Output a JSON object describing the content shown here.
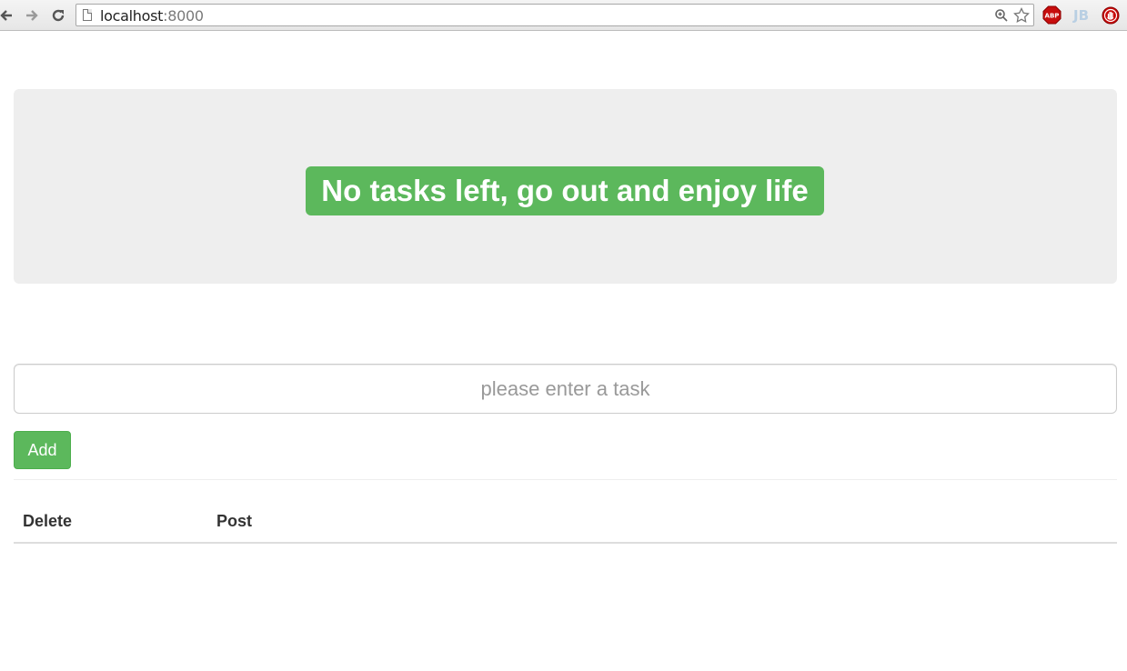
{
  "browser": {
    "url_host": "localhost",
    "url_port": ":8000",
    "icons": {
      "back": "arrow-left-icon",
      "forward": "arrow-right-icon",
      "reload": "reload-icon",
      "page": "page-icon",
      "zoom": "zoom-icon",
      "bookmark": "star-icon"
    },
    "extensions": {
      "abp_label": "ABP",
      "jb_label": "JB"
    }
  },
  "banner": {
    "message": "No tasks left, go out and enjoy life",
    "color": "#5cb85c",
    "background": "#eeeeee"
  },
  "form": {
    "task_placeholder": "please enter a task",
    "task_value": "",
    "add_label": "Add"
  },
  "table": {
    "columns": [
      "Delete",
      "Post"
    ],
    "rows": []
  }
}
